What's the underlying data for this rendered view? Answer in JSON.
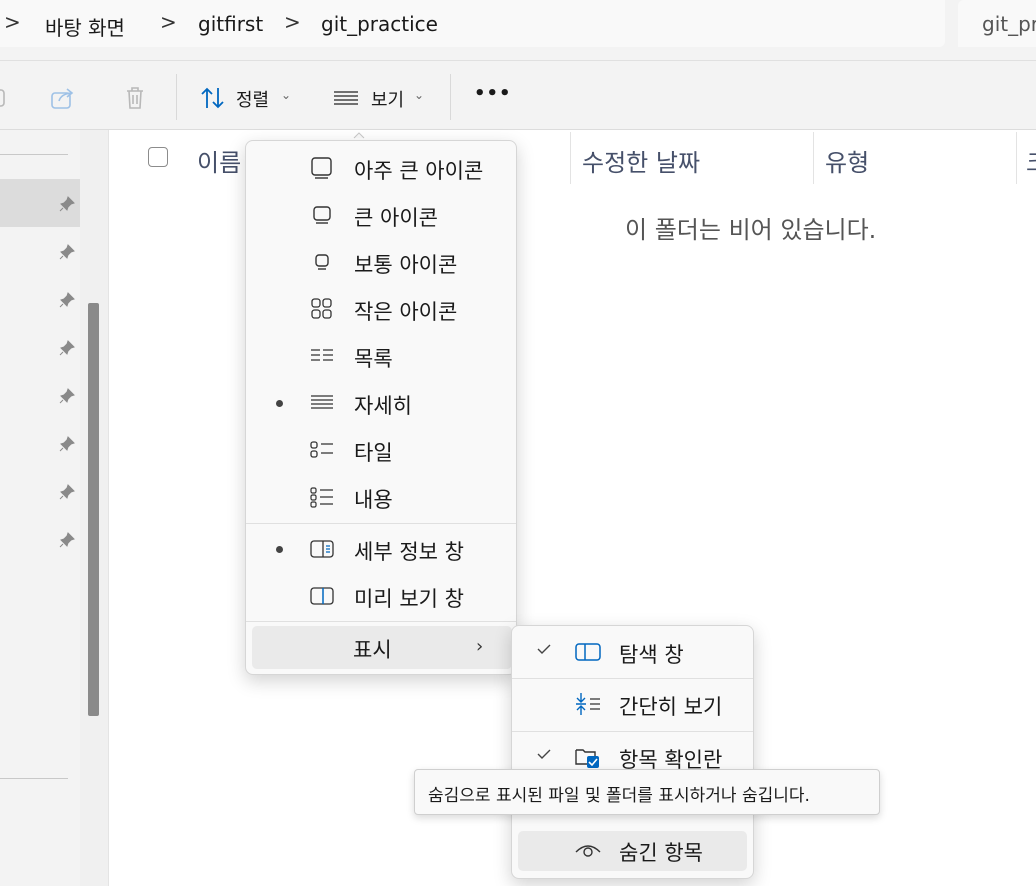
{
  "breadcrumb": {
    "items": [
      "바탕 화면",
      "gitfirst",
      "git_practice"
    ],
    "separator": ">"
  },
  "search": {
    "text": "git_pr"
  },
  "toolbar": {
    "sort_label": "정렬",
    "view_label": "보기",
    "more_label": "•••"
  },
  "columns": {
    "name": "이름",
    "modified": "수정한 날짜",
    "type": "유형",
    "size": "크"
  },
  "content": {
    "empty_message": "이 폴더는 비어 있습니다."
  },
  "view_menu": {
    "items": [
      {
        "label": "아주 큰 아이콘",
        "icon": "extra-large-icons-icon",
        "selected": false
      },
      {
        "label": "큰 아이콘",
        "icon": "large-icons-icon",
        "selected": false
      },
      {
        "label": "보통 아이콘",
        "icon": "medium-icons-icon",
        "selected": false
      },
      {
        "label": "작은 아이콘",
        "icon": "small-icons-icon",
        "selected": false
      },
      {
        "label": "목록",
        "icon": "list-icon",
        "selected": false
      },
      {
        "label": "자세히",
        "icon": "details-icon",
        "selected": true
      },
      {
        "label": "타일",
        "icon": "tiles-icon",
        "selected": false
      },
      {
        "label": "내용",
        "icon": "content-icon",
        "selected": false
      }
    ],
    "panes": [
      {
        "label": "세부 정보 창",
        "icon": "details-pane-icon",
        "selected": true
      },
      {
        "label": "미리 보기 창",
        "icon": "preview-pane-icon",
        "selected": false
      }
    ],
    "show_label": "표시"
  },
  "show_submenu": {
    "items": [
      {
        "label": "탐색 창",
        "icon": "navigation-pane-icon",
        "checked": true
      },
      {
        "label": "간단히 보기",
        "icon": "compact-view-icon",
        "checked": false
      },
      {
        "label": "항목 확인란",
        "icon": "item-checkbox-icon",
        "checked": true
      },
      {
        "label": "숨긴 항목",
        "icon": "eye-icon",
        "checked": false
      }
    ]
  },
  "tooltip": {
    "text": "숨김으로 표시된 파일 및 폴더를 표시하거나 숨깁니다."
  },
  "colors": {
    "accent": "#0067c0",
    "menu_bg": "#f9f9f9",
    "hover": "#eaeaea"
  }
}
